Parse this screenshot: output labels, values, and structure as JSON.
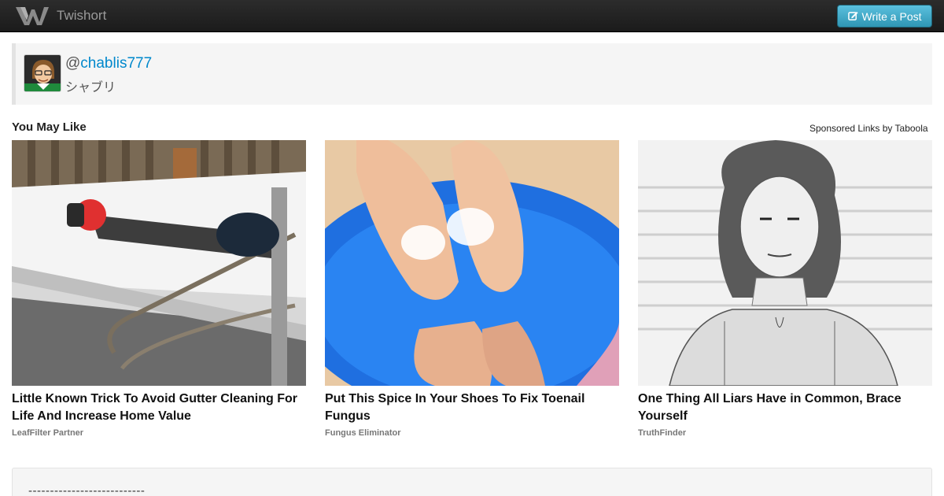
{
  "navbar": {
    "brand_name": "Twishort",
    "write_button_label": "Write a Post"
  },
  "profile": {
    "handle_at": "@",
    "handle": "chablis777",
    "display_name": "シャブリ"
  },
  "recommendations": {
    "title": "You May Like",
    "sponsored_label": "Sponsored Links by Taboola",
    "items": [
      {
        "headline": "Little Known Trick To Avoid Gutter Cleaning For Life And Increase Home Value",
        "source": "LeafFilter Partner"
      },
      {
        "headline": "Put This Spice In Your Shoes To Fix Toenail Fungus",
        "source": "Fungus Eliminator"
      },
      {
        "headline": "One Thing All Liars Have in Common, Brace Yourself",
        "source": "TruthFinder"
      }
    ]
  },
  "post": {
    "text": "---------------------------"
  },
  "colors": {
    "navbar": "#1b1b1b",
    "button": "#2f96b4",
    "link": "#0088cc"
  }
}
